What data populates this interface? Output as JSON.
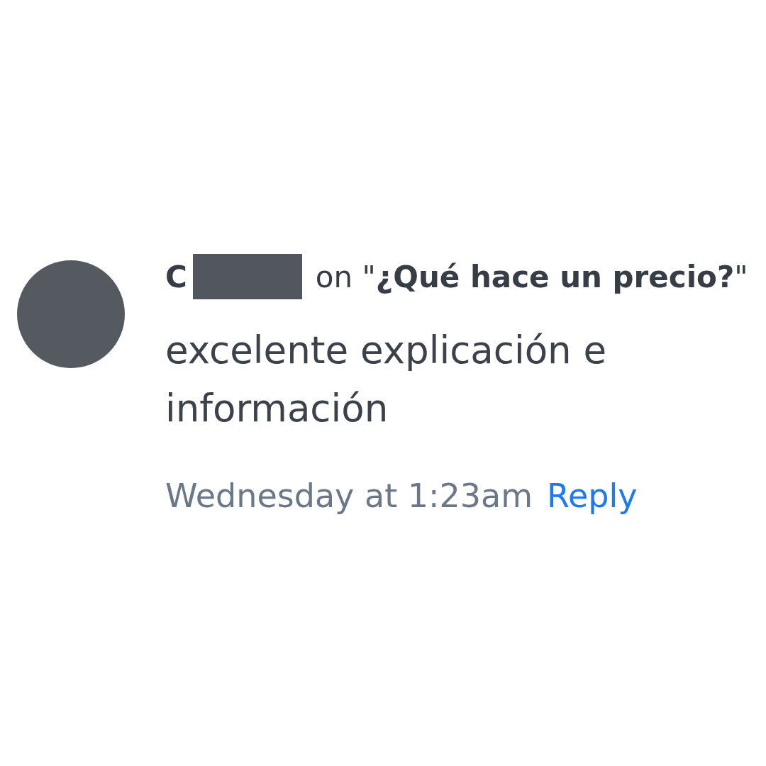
{
  "comment": {
    "author": "C",
    "author_redacted": true,
    "context": "on \"**¿Qué hace un precio?**\"",
    "body": "excelente explicación e información",
    "timestamp": "Wednesday at 1:23am",
    "actions": [
      {
        "label": "Reply",
        "kind": "link"
      }
    ]
  }
}
